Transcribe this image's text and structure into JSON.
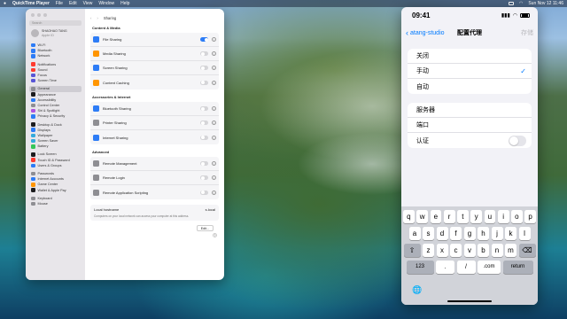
{
  "menubar": {
    "app": "QuickTime Player",
    "items": [
      "File",
      "Edit",
      "View",
      "Window",
      "Help"
    ],
    "clock": "Sun Nov 12  11:46"
  },
  "settings": {
    "title": "Sharing",
    "search_placeholder": "Search",
    "user": {
      "name": "SHAOHAO TANG",
      "sub": "Apple ID"
    },
    "sidebar": [
      {
        "label": "Wi-Fi",
        "color": "#2d7cf6"
      },
      {
        "label": "Bluetooth",
        "color": "#2d7cf6"
      },
      {
        "label": "Network",
        "color": "#2d7cf6"
      },
      {
        "gap": true
      },
      {
        "label": "Notifications",
        "color": "#ff3b30"
      },
      {
        "label": "Sound",
        "color": "#ff3b30"
      },
      {
        "label": "Focus",
        "color": "#5856d6"
      },
      {
        "label": "Screen Time",
        "color": "#5856d6"
      },
      {
        "gap": true
      },
      {
        "label": "General",
        "color": "#8e8e93",
        "selected": true
      },
      {
        "label": "Appearance",
        "color": "#1c1c1e"
      },
      {
        "label": "Accessibility",
        "color": "#2d7cf6"
      },
      {
        "label": "Control Center",
        "color": "#8e8e93"
      },
      {
        "label": "Siri & Spotlight",
        "color": "#af52de"
      },
      {
        "label": "Privacy & Security",
        "color": "#2d7cf6"
      },
      {
        "gap": true
      },
      {
        "label": "Desktop & Dock",
        "color": "#1c1c1e"
      },
      {
        "label": "Displays",
        "color": "#2d7cf6"
      },
      {
        "label": "Wallpaper",
        "color": "#34aadc"
      },
      {
        "label": "Screen Saver",
        "color": "#34aadc"
      },
      {
        "label": "Battery",
        "color": "#34c759"
      },
      {
        "gap": true
      },
      {
        "label": "Lock Screen",
        "color": "#1c1c1e"
      },
      {
        "label": "Touch ID & Password",
        "color": "#ff3b30"
      },
      {
        "label": "Users & Groups",
        "color": "#2d7cf6"
      },
      {
        "gap": true
      },
      {
        "label": "Passwords",
        "color": "#8e8e93"
      },
      {
        "label": "Internet Accounts",
        "color": "#2d7cf6"
      },
      {
        "label": "Game Center",
        "color": "#ff9500"
      },
      {
        "label": "Wallet & Apple Pay",
        "color": "#1c1c1e"
      },
      {
        "gap": true
      },
      {
        "label": "Keyboard",
        "color": "#8e8e93"
      },
      {
        "label": "Mouse",
        "color": "#8e8e93"
      }
    ],
    "sections": [
      {
        "title": "Content & Media",
        "rows": [
          {
            "label": "File Sharing",
            "on": true,
            "color": "#2d7cf6"
          },
          {
            "label": "Media Sharing",
            "on": false,
            "color": "#ff9500"
          },
          {
            "label": "Screen Sharing",
            "on": false,
            "color": "#2d7cf6"
          },
          {
            "label": "Content Caching",
            "on": false,
            "color": "#ff9500"
          }
        ]
      },
      {
        "title": "Accessories & Internet",
        "rows": [
          {
            "label": "Bluetooth Sharing",
            "on": false,
            "color": "#2d7cf6"
          },
          {
            "label": "Printer Sharing",
            "on": false,
            "color": "#8e8e93"
          },
          {
            "label": "Internet Sharing",
            "on": false,
            "color": "#2d7cf6"
          }
        ]
      },
      {
        "title": "Advanced",
        "rows": [
          {
            "label": "Remote Management",
            "on": false,
            "color": "#8e8e93"
          },
          {
            "label": "Remote Login",
            "on": false,
            "color": "#8e8e93"
          },
          {
            "label": "Remote Application Scripting",
            "on": false,
            "color": "#8e8e93"
          }
        ]
      }
    ],
    "host": {
      "label": "Local hostname",
      "value": "s.local",
      "desc": "Computers on your local network can access your computer at this address.",
      "edit": "Edit..."
    },
    "help": "?"
  },
  "phone": {
    "time": "09:41",
    "back_label": "atang-studio",
    "nav_title": "配置代理",
    "save_label": "存储",
    "proxy_modes": [
      {
        "label": "关闭",
        "checked": false
      },
      {
        "label": "手动",
        "checked": true
      },
      {
        "label": "自动",
        "checked": false
      }
    ],
    "checkmark": "✓",
    "fields": {
      "server": "服务器",
      "port": "端口",
      "auth": "认证"
    },
    "keyboard": {
      "row1": [
        "q",
        "w",
        "e",
        "r",
        "t",
        "y",
        "u",
        "i",
        "o",
        "p"
      ],
      "row2": [
        "a",
        "s",
        "d",
        "f",
        "g",
        "h",
        "j",
        "k",
        "l"
      ],
      "row3": [
        "z",
        "x",
        "c",
        "v",
        "b",
        "n",
        "m"
      ],
      "num": "123",
      "dot": ".",
      "slash": "/",
      "dotcom": ".com",
      "return": "return",
      "shift": "⇧",
      "delete": "⌫",
      "globe": "🌐"
    }
  }
}
